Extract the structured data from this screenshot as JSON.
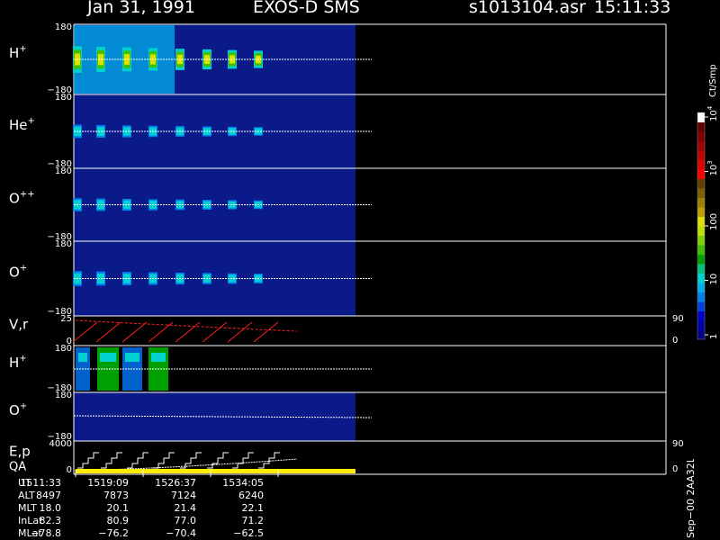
{
  "header": {
    "date": "Jan 31, 1991",
    "instrument": "EXOS-D SMS",
    "file": "s1013104.asr",
    "time": "15:11:33"
  },
  "colorbar": {
    "unit_label": "Ct/Smp",
    "ticks": [
      {
        "label": "1",
        "value": 1
      },
      {
        "label": "10",
        "value": 10
      },
      {
        "label": "100",
        "value": 100
      },
      {
        "label": "10",
        "sup": "3",
        "value": 1000
      },
      {
        "label": "10",
        "sup": "4",
        "value": 10000
      }
    ],
    "colors": [
      "#000088",
      "#0000aa",
      "#0000cc",
      "#0040dd",
      "#0080ee",
      "#00b0ee",
      "#00d0d0",
      "#00c080",
      "#00a000",
      "#40c000",
      "#80d000",
      "#c0e000",
      "#e0e000",
      "#c0a000",
      "#a08000",
      "#806000",
      "#604000",
      "#ff0000",
      "#e00000",
      "#c00000",
      "#a00000",
      "#800000",
      "#600000",
      "#ffffff"
    ]
  },
  "panels": [
    {
      "id": "h-plus",
      "species": "H",
      "charge": "+",
      "ymax": "180",
      "ymin": "−180"
    },
    {
      "id": "he-plus",
      "species": "He",
      "charge": "+",
      "ymax": "180",
      "ymin": "−180"
    },
    {
      "id": "o-plusplus",
      "species": "O",
      "charge": "++",
      "ymax": "180",
      "ymin": "−180"
    },
    {
      "id": "o-plus",
      "species": "O",
      "charge": "+",
      "ymax": "180",
      "ymin": "−180"
    },
    {
      "id": "vr",
      "species": "V,r",
      "charge": "",
      "ymax": "25",
      "ymin": "0",
      "rmax": "90",
      "rmin": "0"
    },
    {
      "id": "h-plus-2",
      "species": "H",
      "charge": "+",
      "ymax": "180",
      "ymin": "−180"
    },
    {
      "id": "o-plus-2",
      "species": "O",
      "charge": "+",
      "ymax": "180",
      "ymin": "−180"
    },
    {
      "id": "ep-qa",
      "species": "E,p",
      "species2": "QA",
      "charge": "",
      "ymax": "4000",
      "ymin": "0",
      "rmax": "90",
      "rmin": "0"
    }
  ],
  "chart_data": {
    "type": "heatmap",
    "x": [
      "1511:33",
      "1519:09",
      "1526:37",
      "1534:05"
    ],
    "tick_labels": [
      "1511:33",
      "1519:09",
      "1526:37",
      "1534:05"
    ],
    "colorscale": "log",
    "colorscale_range": [
      1,
      10000
    ],
    "colorbar_unit": "Ct/Smp",
    "panels": [
      "H+",
      "He+",
      "O++",
      "O+",
      "V,r",
      "H+",
      "O+",
      "E,p / QA"
    ],
    "pitch_angle_range": [
      -180,
      180
    ],
    "vr_range": [
      0,
      25
    ],
    "vr_right_range": [
      0,
      90
    ],
    "ep_range": [
      0,
      4000
    ],
    "ep_right_range": [
      0,
      90
    ],
    "data_end_fraction": 0.5
  },
  "info_table": {
    "rows": [
      {
        "label": "UT",
        "values": [
          "1511:33",
          "1519:09",
          "1526:37",
          "1534:05"
        ]
      },
      {
        "label": "ALT",
        "values": [
          "8497",
          "7873",
          "7124",
          "6240"
        ]
      },
      {
        "label": "MLT",
        "values": [
          "18.0",
          "20.1",
          "21.4",
          "22.1"
        ]
      },
      {
        "label": "InLat",
        "values": [
          "82.3",
          "80.9",
          "77.0",
          "71.2"
        ]
      },
      {
        "label": "MLat",
        "values": [
          "−78.8",
          "−76.2",
          "−70.4",
          "−62.5"
        ]
      }
    ]
  },
  "stamp": "Sep−00 2AA32L"
}
